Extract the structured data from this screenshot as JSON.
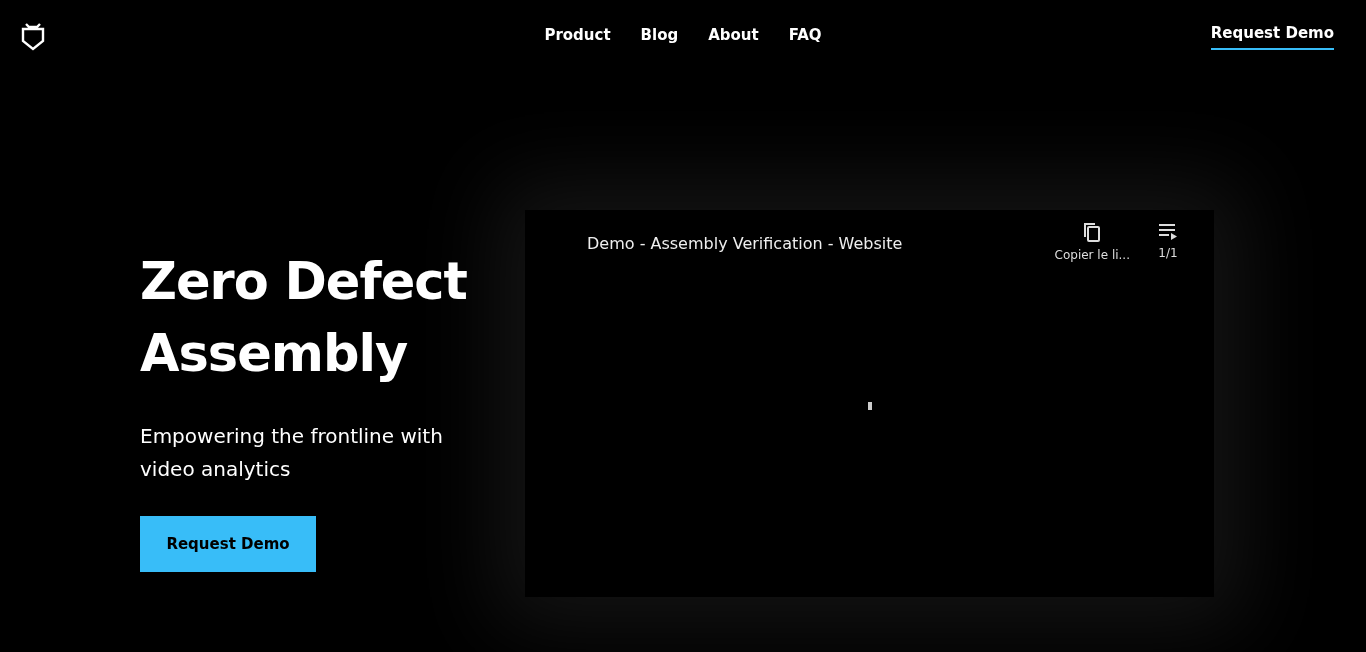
{
  "nav": {
    "links": [
      "Product",
      "Blog",
      "About",
      "FAQ"
    ],
    "cta": "Request Demo"
  },
  "hero": {
    "title_lines": [
      "Zero Defect",
      "Assembly"
    ],
    "subtitle": "Empowering the frontline with video analytics",
    "button": "Request Demo"
  },
  "video": {
    "title": "Demo - Assembly Verification - Website",
    "copy_label": "Copier le li...",
    "playlist_label": "1/1"
  }
}
